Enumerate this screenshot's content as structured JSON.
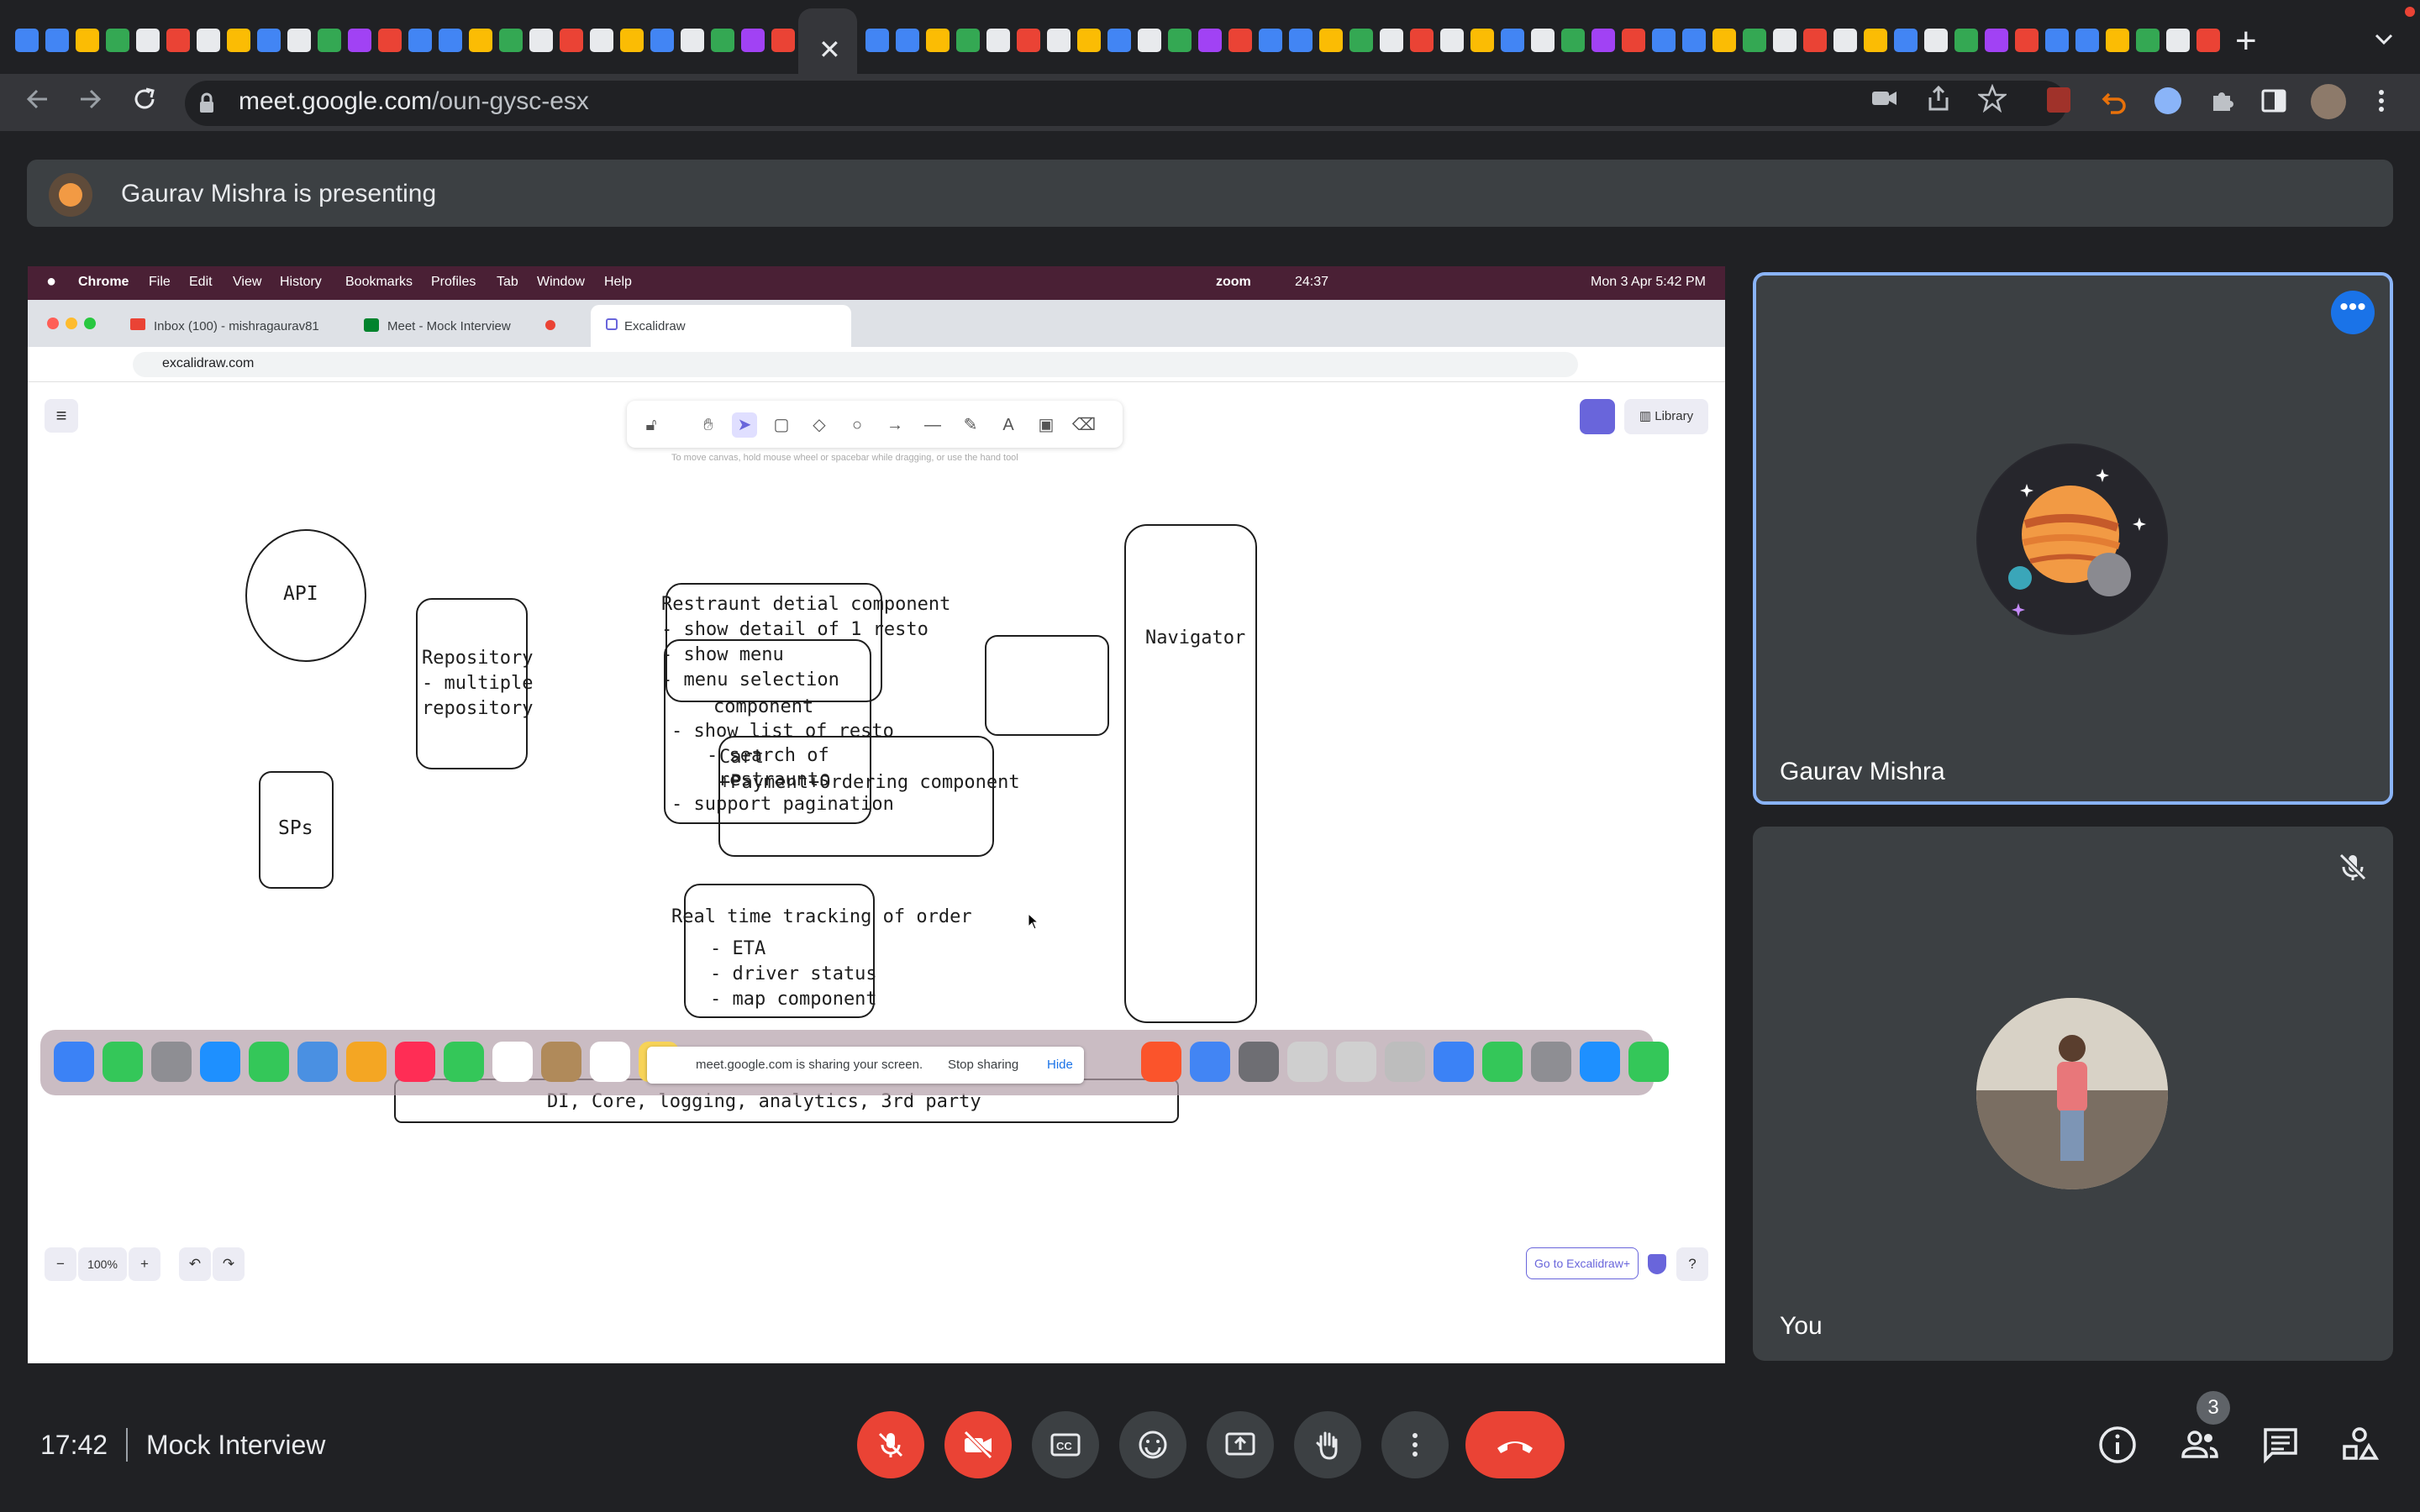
{
  "browser": {
    "url_host": "meet.google.com",
    "url_path": "/oun-gysc-esx",
    "active_tab_close": "✕",
    "new_tab": "+"
  },
  "presenting": {
    "text": "Gaurav Mishra is presenting"
  },
  "shared_screen": {
    "menubar": {
      "app": "Chrome",
      "items": [
        "File",
        "Edit",
        "View",
        "History",
        "Bookmarks",
        "Profiles",
        "Tab",
        "Window",
        "Help"
      ],
      "zoom": "zoom",
      "zoom_timer": "24:37",
      "datetime": "Mon 3 Apr  5:42 PM"
    },
    "tabs": [
      {
        "label": "Inbox (100) - mishragaurav81"
      },
      {
        "label": "Meet - Mock Interview"
      },
      {
        "label": "Excalidraw"
      }
    ],
    "url": "excalidraw.com",
    "library_label": "Library",
    "hint": "To move canvas, hold mouse wheel or spacebar while dragging, or use the hand tool",
    "zoom_level": "100%",
    "go_excalidraw_plus": "Go to Excalidraw+",
    "diagram": {
      "top_block": [
        "component",
        "- show list of resto",
        "- search of",
        "restraunts",
        "- support pagination"
      ],
      "api": "API",
      "repository": [
        "Repository",
        "- multiple",
        "repository"
      ],
      "sps": "SPs",
      "detail": [
        "Restraunt detial component",
        "- show detail of 1 resto",
        "- show menu",
        "- menu selection"
      ],
      "cart": [
        "Cart",
        "+Payment+Ordering component"
      ],
      "tracking": [
        "Real time tracking of order",
        "- ETA",
        "- driver status",
        "- map component"
      ],
      "navigator": "Navigator",
      "bottom": "DI, Core, logging, analytics, 3rd party"
    },
    "share_notice": {
      "text": "meet.google.com is sharing your screen.",
      "stop": "Stop sharing",
      "hide": "Hide"
    }
  },
  "participants": [
    {
      "name": "Gaurav Mishra",
      "more": "•••"
    },
    {
      "name": "You"
    }
  ],
  "bottom_bar": {
    "time": "17:42",
    "meeting_name": "Mock Interview",
    "people_count": "3"
  },
  "colors": {
    "meet_bg": "#202124",
    "tile_bg": "#3c4043",
    "danger": "#ea4335",
    "accent": "#8ab4f8",
    "excalidraw_purple": "#6965db"
  }
}
